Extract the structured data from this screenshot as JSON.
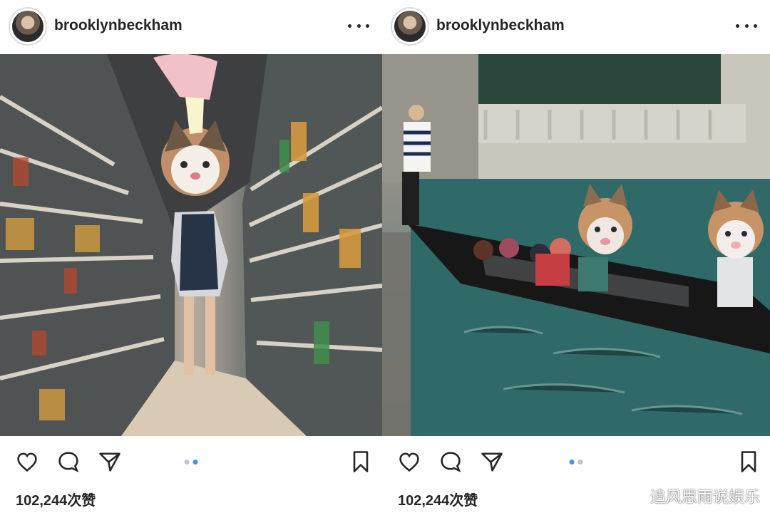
{
  "posts": [
    {
      "username": "brooklynbeckham",
      "likes": "102,244次赞",
      "carousel": {
        "count": 2,
        "active": 2
      }
    },
    {
      "username": "brooklynbeckham",
      "likes": "102,244次赞",
      "carousel": {
        "count": 2,
        "active": 1
      }
    }
  ],
  "icons": [
    "heart-icon",
    "comment-icon",
    "send-icon",
    "bookmark-icon",
    "more-icon"
  ],
  "colors": {
    "text": "#262626",
    "carousel_active": "#3897f0",
    "carousel_inactive": "#b9c4cf",
    "background": "#ffffff"
  },
  "watermark": "追风思雨说娱乐"
}
